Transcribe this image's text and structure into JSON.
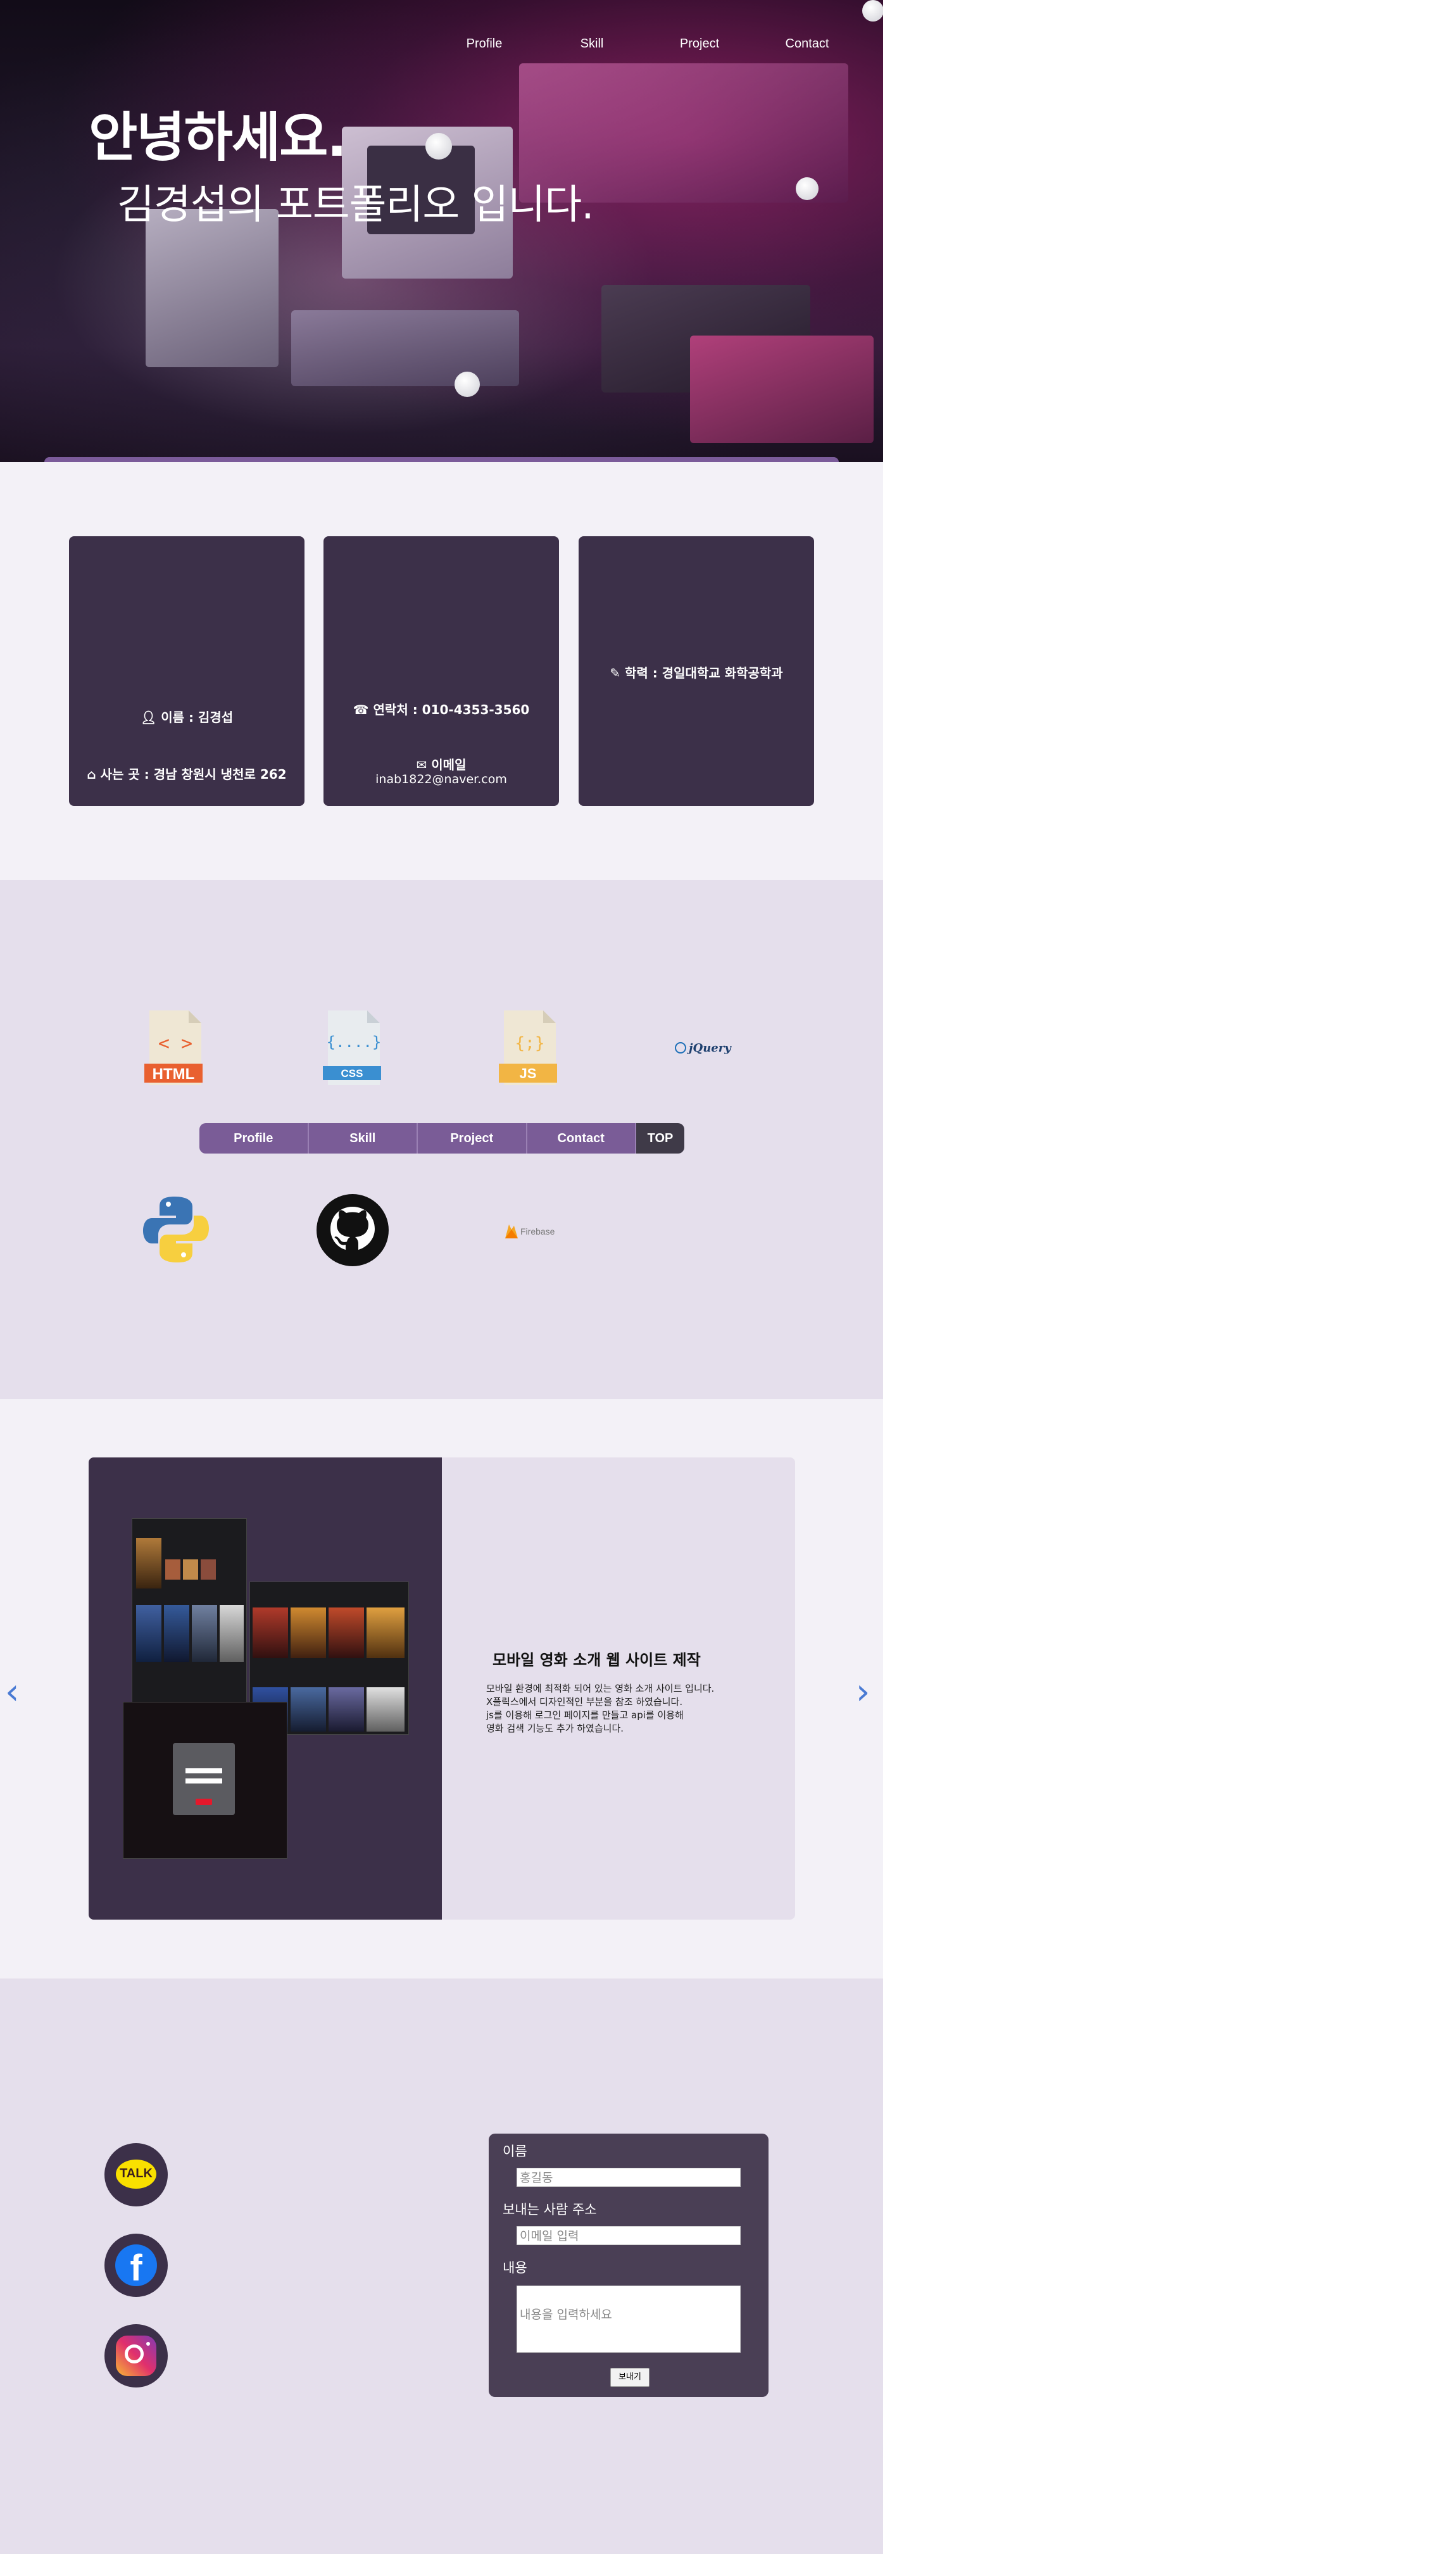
{
  "nav": {
    "items": [
      "Profile",
      "Skill",
      "Project",
      "Contact"
    ]
  },
  "hero": {
    "greeting": "안녕하세요.",
    "intro": "김경섭의 포트폴리오 입니다."
  },
  "profile": {
    "card1": {
      "name": "이름 : 김경섭",
      "address": "사는 곳 : 경남 창원시 냉천로 262"
    },
    "card2": {
      "phone": "연락처 : 010-4353-3560",
      "email_label": "이메일",
      "email": "inab1822@naver.com"
    },
    "card3": {
      "education": "학력 : 경일대학교 화학공학과"
    },
    "icons": [
      "user-icon",
      "home-icon",
      "phone-icon",
      "envelope-icon",
      "pencil-icon"
    ]
  },
  "skill": {
    "row1": [
      {
        "name": "html-icon",
        "label": "HTML",
        "color": "#e9602f"
      },
      {
        "name": "css-icon",
        "label": "CSS",
        "color": "#3a8fd1"
      },
      {
        "name": "js-icon",
        "label": "JS",
        "color": "#f2b544"
      },
      {
        "name": "jquery-logo",
        "label": "jQuery",
        "color": "#1d6fb8"
      }
    ],
    "row2": [
      {
        "name": "python-logo"
      },
      {
        "name": "github-logo"
      },
      {
        "name": "firebase-logo",
        "label": "Firebase",
        "color": "#f5a623"
      }
    ],
    "subnav": [
      "Profile",
      "Skill",
      "Project",
      "Contact",
      "TOP"
    ]
  },
  "project": {
    "title": "모바일 영화 소개 웹 사이트 제작",
    "description": "모바일 환경에 최적화 되어 있는 영화 소개 사이트 입니다.\nX플릭스에서 디자인적인 부분을 참조 하였습니다.\njs를 이용해 로그인 페이지를 만들고 api를 이용해\n영화 검색 기능도 추가 하였습니다.",
    "prev": "‹",
    "next": "›"
  },
  "contact": {
    "social": [
      {
        "name": "kakaotalk-icon",
        "label": "TALK"
      },
      {
        "name": "facebook-icon",
        "label": "f"
      },
      {
        "name": "instagram-icon",
        "label": ""
      }
    ],
    "form": {
      "name_label": "이름",
      "name_placeholder": "홍길동",
      "email_label": "보내는 사람 주소",
      "email_placeholder": "이메일 입력",
      "message_label": "내용",
      "message_placeholder": "내용을 입력하세요",
      "send_label": "보내기"
    }
  },
  "colors": {
    "accent": "#7b5b9a",
    "card": "#3c3049",
    "section_light": "#f3f1f7",
    "section_lavender": "#e5dfec",
    "arrow": "#4a7bd4"
  }
}
